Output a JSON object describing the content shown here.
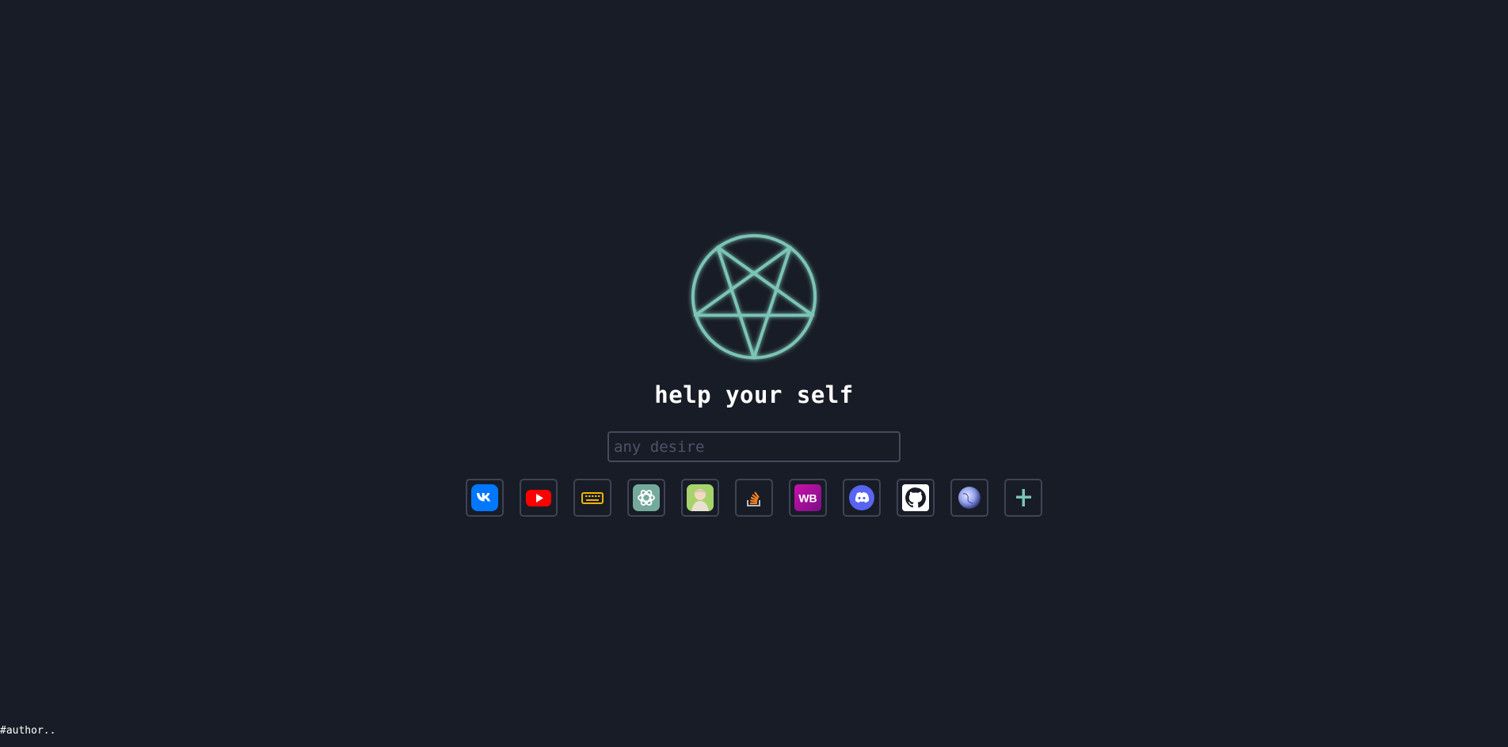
{
  "colors": {
    "background": "#181c26",
    "accent": "#7cc4b6",
    "border": "#3e4456"
  },
  "logo": {
    "icon": "pentagram-icon"
  },
  "title": "help your self",
  "search": {
    "placeholder": "any desire",
    "value": ""
  },
  "shortcuts": [
    {
      "icon": "vk-icon"
    },
    {
      "icon": "youtube-icon"
    },
    {
      "icon": "keyboard-icon"
    },
    {
      "icon": "chatgpt-icon"
    },
    {
      "icon": "anime-avatar-icon"
    },
    {
      "icon": "stackoverflow-icon"
    },
    {
      "icon": "wildberries-icon",
      "label": "WB"
    },
    {
      "icon": "discord-icon"
    },
    {
      "icon": "github-icon"
    },
    {
      "icon": "globe-icon"
    },
    {
      "icon": "plus-icon"
    }
  ],
  "footer": {
    "author": "#author.."
  }
}
